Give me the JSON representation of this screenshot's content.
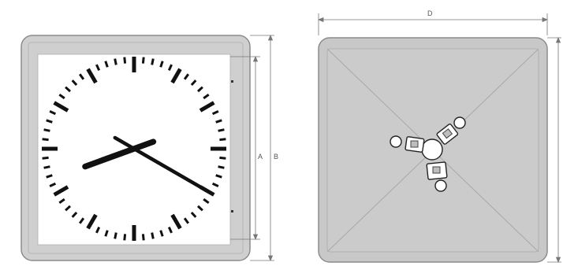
{
  "front_view": {
    "dimension_labels": {
      "a": "A",
      "b": "B"
    },
    "clock_time": {
      "hour": 8,
      "minute": 20
    },
    "colors": {
      "bezel": "#cfcfcf",
      "bezel_edge": "#8c8c8c",
      "dial": "#ffffff",
      "marks": "#111111",
      "dimension_lines": "#777777"
    }
  },
  "back_view": {
    "dimension_labels": {
      "d": "D"
    },
    "colors": {
      "panel": "#c8c8c8",
      "panel_edge": "#8c8c8c",
      "creases": "#a8a8a8",
      "mount": "#ffffff",
      "mount_outline": "#222222"
    }
  }
}
